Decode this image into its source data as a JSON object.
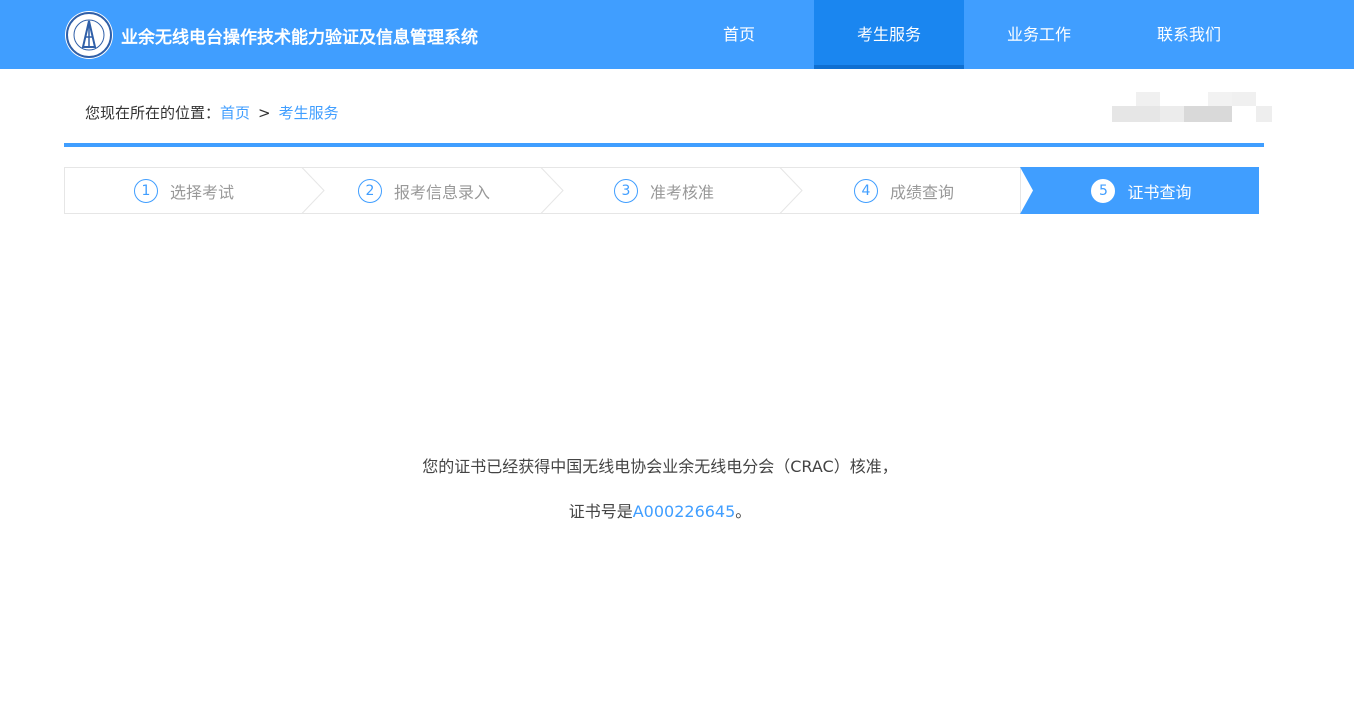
{
  "header": {
    "title": "业余无线电台操作技术能力验证及信息管理系统",
    "nav": [
      {
        "label": "首页",
        "active": false
      },
      {
        "label": "考生服务",
        "active": true
      },
      {
        "label": "业务工作",
        "active": false
      },
      {
        "label": "联系我们",
        "active": false
      }
    ]
  },
  "breadcrumb": {
    "prefix": "您现在所在的位置：",
    "home": "首页",
    "separator": ">",
    "current": "考生服务"
  },
  "steps": [
    {
      "num": "1",
      "label": "选择考试"
    },
    {
      "num": "2",
      "label": "报考信息录入"
    },
    {
      "num": "3",
      "label": "准考核准"
    },
    {
      "num": "4",
      "label": "成绩查询"
    },
    {
      "num": "5",
      "label": "证书查询",
      "active": true
    }
  ],
  "message": {
    "line1": "您的证书已经获得中国无线电协会业余无线电分会（CRAC）核准，",
    "line2_prefix": "证书号是",
    "certificate_number": "A000226645",
    "line2_suffix": "。"
  },
  "colors": {
    "primary": "#409eff",
    "nav_active": "#1a86f0"
  }
}
